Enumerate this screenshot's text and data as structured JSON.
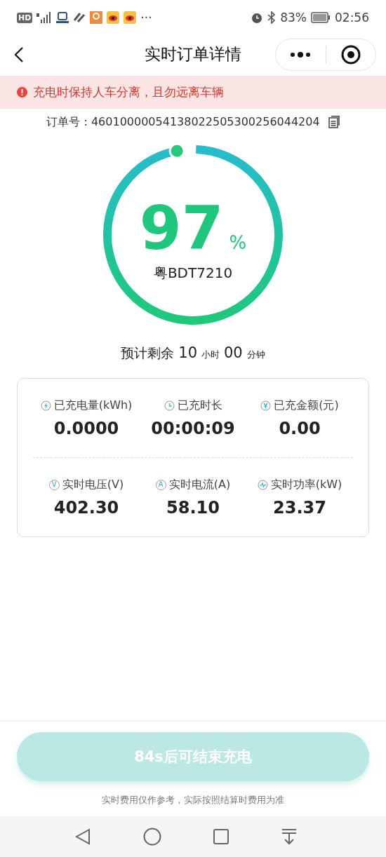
{
  "status_bar": {
    "battery": "83%",
    "time": "02:56",
    "left_badge": "HD",
    "more": "···"
  },
  "header": {
    "title": "实时订单详情"
  },
  "warning": {
    "text": "充电时保持人车分离，且勿远离车辆"
  },
  "order": {
    "label": "订单号 : 46010000054138022505300256044204"
  },
  "ring": {
    "level": 0.97,
    "percent": "97",
    "unit": "%",
    "plate": "粤BDT7210"
  },
  "remaining": {
    "prefix": "预计剩余",
    "hours": "10",
    "hours_unit": "小时",
    "minutes": "00",
    "minutes_unit": "分钟"
  },
  "stats": [
    [
      {
        "kind": "bolt",
        "label": "已充电量(kWh)",
        "value": "0.0000"
      },
      {
        "kind": "clock",
        "label": "已充时长",
        "value": "00:00:09"
      },
      {
        "kind": "yen",
        "label": "已充金额(元)",
        "value": "0.00"
      }
    ],
    [
      {
        "kind": "letter",
        "glyph": "V",
        "label": "实时电压(V)",
        "value": "402.30"
      },
      {
        "kind": "letter",
        "glyph": "A",
        "label": "实时电流(A)",
        "value": "58.10"
      },
      {
        "kind": "pulse",
        "label": "实时功率(kW)",
        "value": "23.37"
      }
    ]
  ],
  "end_button": {
    "label": "84s后可结束充电",
    "disabled": true
  },
  "note": "实时费用仅作参考，实际按照结算时费用为准"
}
